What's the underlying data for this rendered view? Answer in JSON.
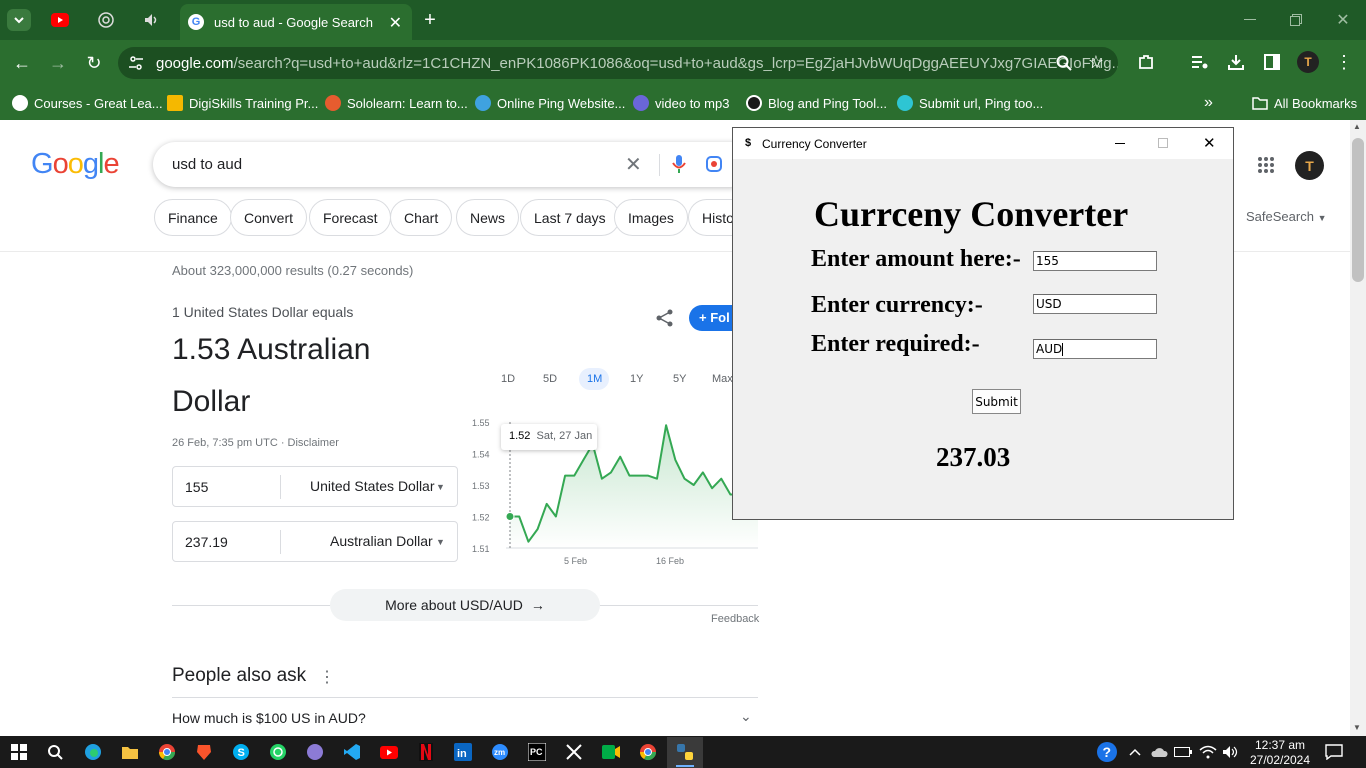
{
  "browser": {
    "active_tab_title": "usd to aud - Google Search",
    "url_host": "google.com",
    "url_rest": "/search?q=usd+to+aud&rlz=1C1CHZN_enPK1086PK1086&oq=usd+to+aud&gs_lcrp=EgZjaHJvbWUqDggAEEUYJxg7GIAEGIoFMg...",
    "bookmarks": [
      "Courses - Great Lea...",
      "DigiSkills Training Pr...",
      "Sololearn: Learn to...",
      "Online Ping Website...",
      "video to mp3",
      "Blog and Ping Tool...",
      "Submit url, Ping too..."
    ],
    "all_bookmarks": "All Bookmarks"
  },
  "google": {
    "search_query": "usd to aud",
    "chips": [
      "Finance",
      "Convert",
      "Forecast",
      "Chart",
      "News",
      "Last 7 days",
      "Images",
      "Histo"
    ],
    "safesearch": "SafeSearch",
    "results_stats": "About 323,000,000 results (0.27 seconds)",
    "equals_text": "1 United States Dollar equals",
    "rate_line1": "1.53 Australian",
    "rate_line2": "Dollar",
    "timestamp": "26 Feb, 7:35 pm UTC · Disclaimer",
    "follow_label": "+ Fol",
    "amount_from": "155",
    "currency_from": "United States Dollar",
    "amount_to": "237.19",
    "currency_to": "Australian Dollar",
    "ranges": [
      "1D",
      "5D",
      "1M",
      "1Y",
      "5Y",
      "Max"
    ],
    "active_range": "1M",
    "tooltip_value": "1.52",
    "tooltip_date": "Sat, 27 Jan",
    "more_about": "More about USD/AUD",
    "feedback": "Feedback",
    "people_also_ask": "People also ask",
    "paa_question": "How much is $100 US in AUD?"
  },
  "chart_data": {
    "type": "line",
    "y_ticks": [
      1.55,
      1.54,
      1.53,
      1.52,
      1.51
    ],
    "x_ticks": [
      "5 Feb",
      "16 Feb"
    ],
    "ylim": [
      1.51,
      1.55
    ],
    "values": [
      1.52,
      1.52,
      1.512,
      1.516,
      1.524,
      1.52,
      1.533,
      1.533,
      1.538,
      1.543,
      1.532,
      1.534,
      1.539,
      1.533,
      1.533,
      1.533,
      1.532,
      1.549,
      1.538,
      1.532,
      1.53,
      1.534,
      1.529,
      1.532,
      1.527,
      1.527,
      1.525,
      1.527
    ],
    "color": "#34a853"
  },
  "dialog": {
    "window_title": "Currency Converter",
    "heading": "Currceny Converter",
    "label_amount": "Enter amount here:-",
    "label_currency": "Enter currency:-",
    "label_required": "Enter required:-",
    "value_amount": "155",
    "value_currency": "USD",
    "value_required": "AUD",
    "submit_label": "Submit",
    "result": "237.03"
  },
  "taskbar": {
    "time": "12:37 am",
    "date": "27/02/2024"
  }
}
